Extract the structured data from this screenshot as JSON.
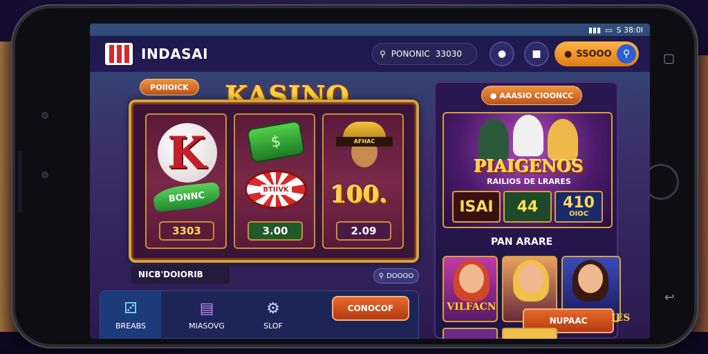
{
  "status_bar": {
    "time": "S 38:0I",
    "signal": "▮▮▮",
    "battery": "▭"
  },
  "header": {
    "app_title": "INDASAI",
    "search_label": "PONONIC",
    "search_value": "33030",
    "action_button": "SSOOO",
    "icons": [
      "search-icon",
      "coin-icon",
      "shield-icon",
      "bookmark-icon"
    ]
  },
  "slot": {
    "tag": "POIIOICK",
    "title": "KASINO",
    "reels": [
      {
        "symbol_top": "K",
        "symbol_bottom": "BONNC",
        "value": "3303"
      },
      {
        "symbol_top": "$",
        "symbol_bottom": "BTIIVK",
        "value": "3.00"
      },
      {
        "symbol_top": "AFHAC",
        "symbol_bottom": "100.",
        "value": "2.09"
      }
    ],
    "footer_label": "NICB'DOIORIB",
    "footer_tag": "DOOOO"
  },
  "bottom_nav": {
    "tabs": [
      {
        "label": "BREABS",
        "icon": "dice-icon"
      },
      {
        "label": "MIASOVG",
        "icon": "wallet-icon"
      },
      {
        "label": "SLOF",
        "icon": "gear-icon"
      }
    ],
    "contact_button": "CONOCOF"
  },
  "promo": {
    "pill": "AAASIO CIOONCC",
    "title": "PIAIGENOS",
    "subtitle": "RAILIOS DE LRARES",
    "numbers": [
      "ISAI",
      "44",
      "410"
    ],
    "number_sub": "OIOC"
  },
  "games": {
    "section_label": "PAN ARARE",
    "thumbs": [
      "VILFACN",
      "",
      ""
    ],
    "play_button": "NUPAAC",
    "side_label": "IES"
  },
  "colors": {
    "accent_orange": "#e07b14",
    "gold": "#ffd23a",
    "frame_gold": "#d6a43a",
    "panel": "#1d2458"
  }
}
